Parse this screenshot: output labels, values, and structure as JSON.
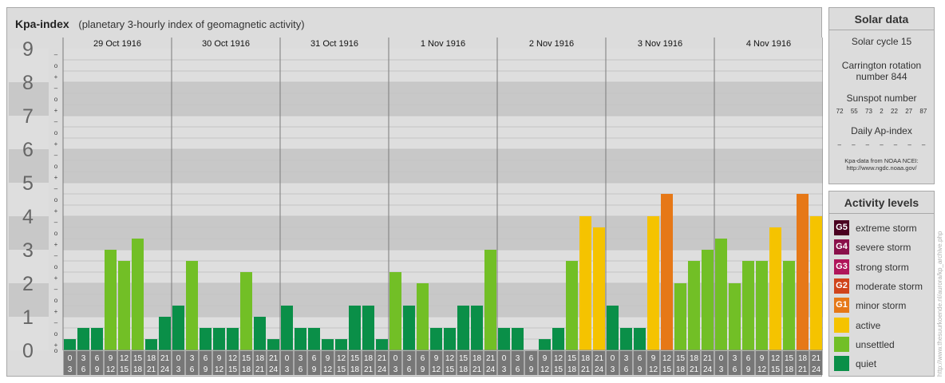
{
  "title": "Kpa-index",
  "subtitle": "(planetary 3-hourly index of geomagnetic activity)",
  "colors": {
    "quiet": "#0a8f48",
    "unsettled": "#72bf26",
    "active": "#f5c300",
    "minor": "#e67817",
    "moderate": "#d0431b",
    "strong": "#b0155a",
    "severe": "#8a104a",
    "extreme": "#4a0020",
    "band_dark": "#c8c8c8",
    "band_light": "#dedede"
  },
  "chart_data": {
    "type": "bar",
    "title": "Kpa-index",
    "ylim": [
      0,
      9
    ],
    "y_ticks": [
      "0",
      "1",
      "2",
      "3",
      "4",
      "5",
      "6",
      "7",
      "8",
      "9"
    ],
    "sub_ticks": [
      "+",
      "o",
      "–"
    ],
    "days": [
      "29 Oct 1916",
      "30 Oct 1916",
      "31 Oct 1916",
      "1 Nov 1916",
      "2 Nov 1916",
      "3 Nov 1916",
      "4 Nov 1916"
    ],
    "interval_top": [
      "0",
      "3",
      "6",
      "9",
      "12",
      "15",
      "18",
      "21"
    ],
    "interval_bottom": [
      "3",
      "6",
      "9",
      "12",
      "15",
      "18",
      "21",
      "24"
    ],
    "values": [
      [
        0.333,
        0.667,
        0.667,
        3.0,
        2.667,
        3.333,
        0.333,
        1.0
      ],
      [
        1.333,
        2.667,
        0.667,
        0.667,
        0.667,
        2.333,
        1.0,
        0.333
      ],
      [
        1.333,
        0.667,
        0.667,
        0.333,
        0.333,
        1.333,
        1.333,
        0.333
      ],
      [
        2.333,
        1.333,
        2.0,
        0.667,
        0.667,
        1.333,
        1.333,
        3.0
      ],
      [
        0.667,
        0.667,
        0.0,
        0.333,
        0.667,
        2.667,
        4.0,
        3.667
      ],
      [
        1.333,
        0.667,
        0.667,
        4.0,
        4.667,
        2.0,
        2.667,
        3.0
      ],
      [
        3.333,
        2.0,
        2.667,
        2.667,
        3.667,
        2.667,
        4.667,
        4.0
      ]
    ]
  },
  "solar": {
    "header": "Solar data",
    "cycle": "Solar cycle 15",
    "carrington_1": "Carrington rotation",
    "carrington_2": "number 844",
    "sunspot_label": "Sunspot number",
    "sunspots": [
      "72",
      "55",
      "73",
      "2",
      "22",
      "27",
      "87"
    ],
    "ap_label": "Daily Ap-index",
    "ap": [
      "–",
      "–",
      "–",
      "–",
      "–",
      "–",
      "–"
    ],
    "credit_1": "Kpa-data from NOAA NCEI:",
    "credit_2": "http://www.ngdc.noaa.gov/"
  },
  "activity": {
    "header": "Activity levels",
    "levels": [
      {
        "code": "G5",
        "label": "extreme storm",
        "color": "#4a0020"
      },
      {
        "code": "G4",
        "label": "severe storm",
        "color": "#8a104a"
      },
      {
        "code": "G3",
        "label": "strong storm",
        "color": "#b0155a"
      },
      {
        "code": "G2",
        "label": "moderate storm",
        "color": "#d0431b"
      },
      {
        "code": "G1",
        "label": "minor storm",
        "color": "#e67817"
      },
      {
        "code": "",
        "label": "active",
        "color": "#f5c300"
      },
      {
        "code": "",
        "label": "unsettled",
        "color": "#72bf26"
      },
      {
        "code": "",
        "label": "quiet",
        "color": "#0a8f48"
      }
    ]
  },
  "watermark": "http://www.thesuurkoende.nl/aurora/kp_archive.php"
}
